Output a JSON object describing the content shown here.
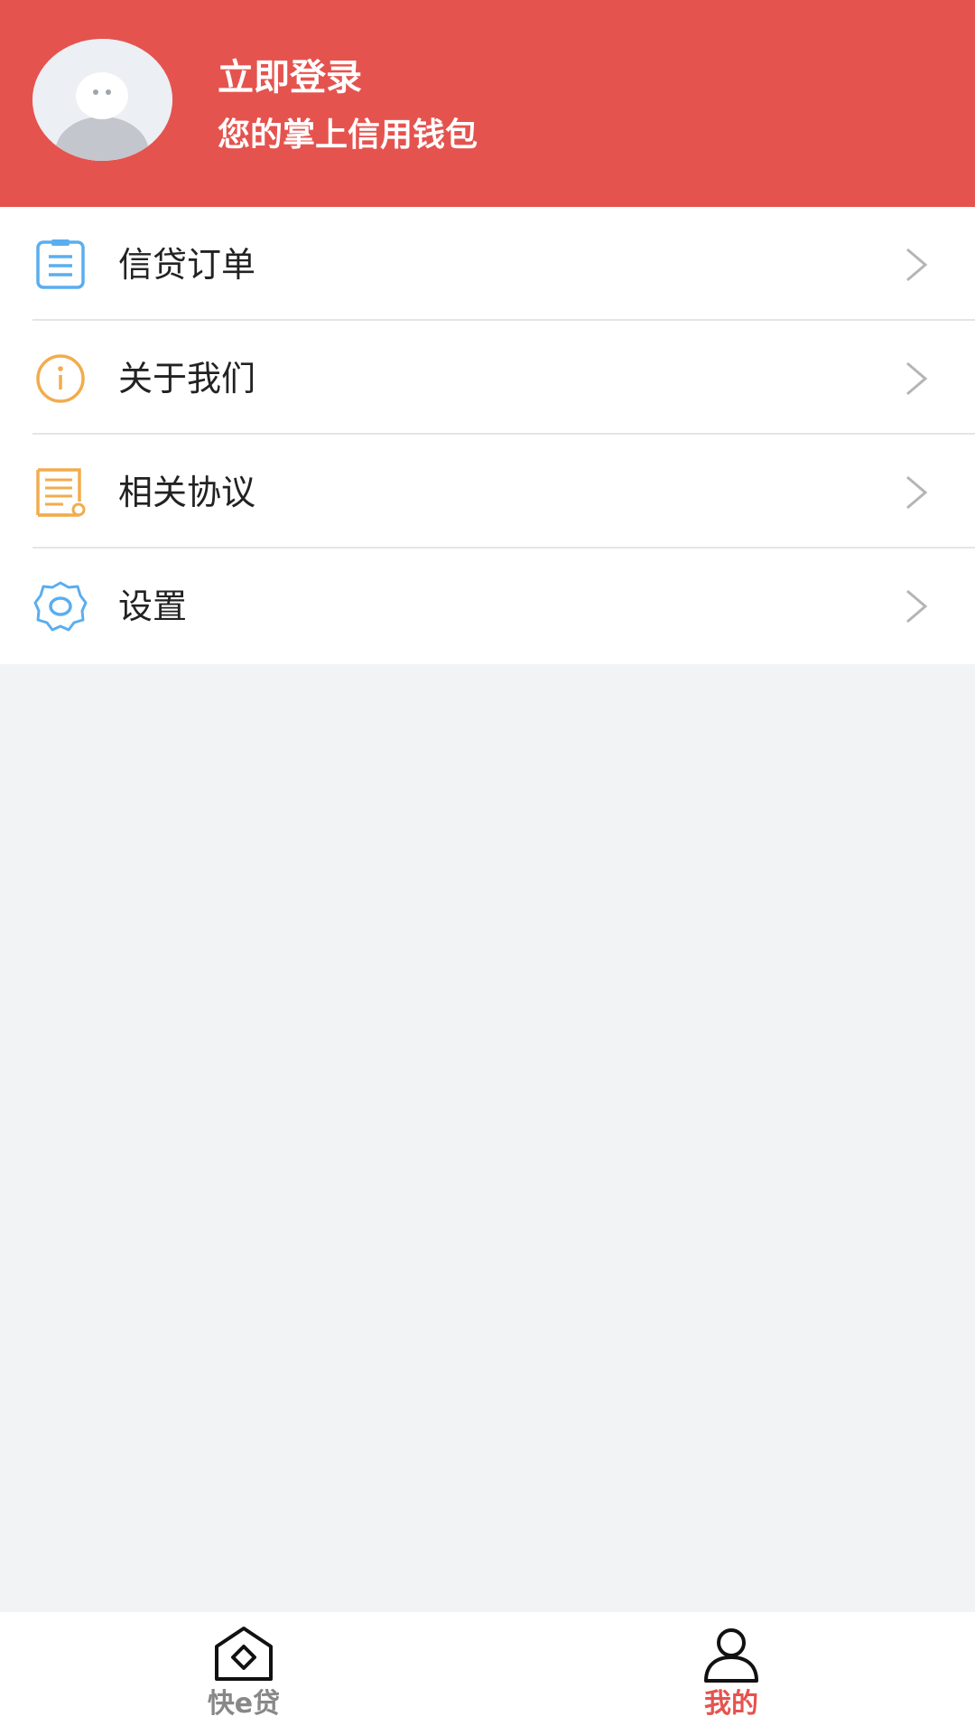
{
  "header": {
    "title": "立即登录",
    "subtitle": "您的掌上信用钱包",
    "background_color": "#e5534f"
  },
  "menu": {
    "items": [
      {
        "label": "信贷订单",
        "icon": "clipboard-list-icon",
        "icon_color": "#5aaeef"
      },
      {
        "label": "关于我们",
        "icon": "info-circle-icon",
        "icon_color": "#f2ac4c"
      },
      {
        "label": "相关协议",
        "icon": "agreement-document-icon",
        "icon_color": "#f2ac4c"
      },
      {
        "label": "设置",
        "icon": "gear-icon",
        "icon_color": "#5aaeef"
      }
    ]
  },
  "tabbar": {
    "tabs": [
      {
        "label": "快e贷",
        "icon": "home-diamond-icon",
        "active": false,
        "color": "#888888"
      },
      {
        "label": "我的",
        "icon": "person-icon",
        "active": true,
        "color": "#e5534f"
      }
    ]
  }
}
